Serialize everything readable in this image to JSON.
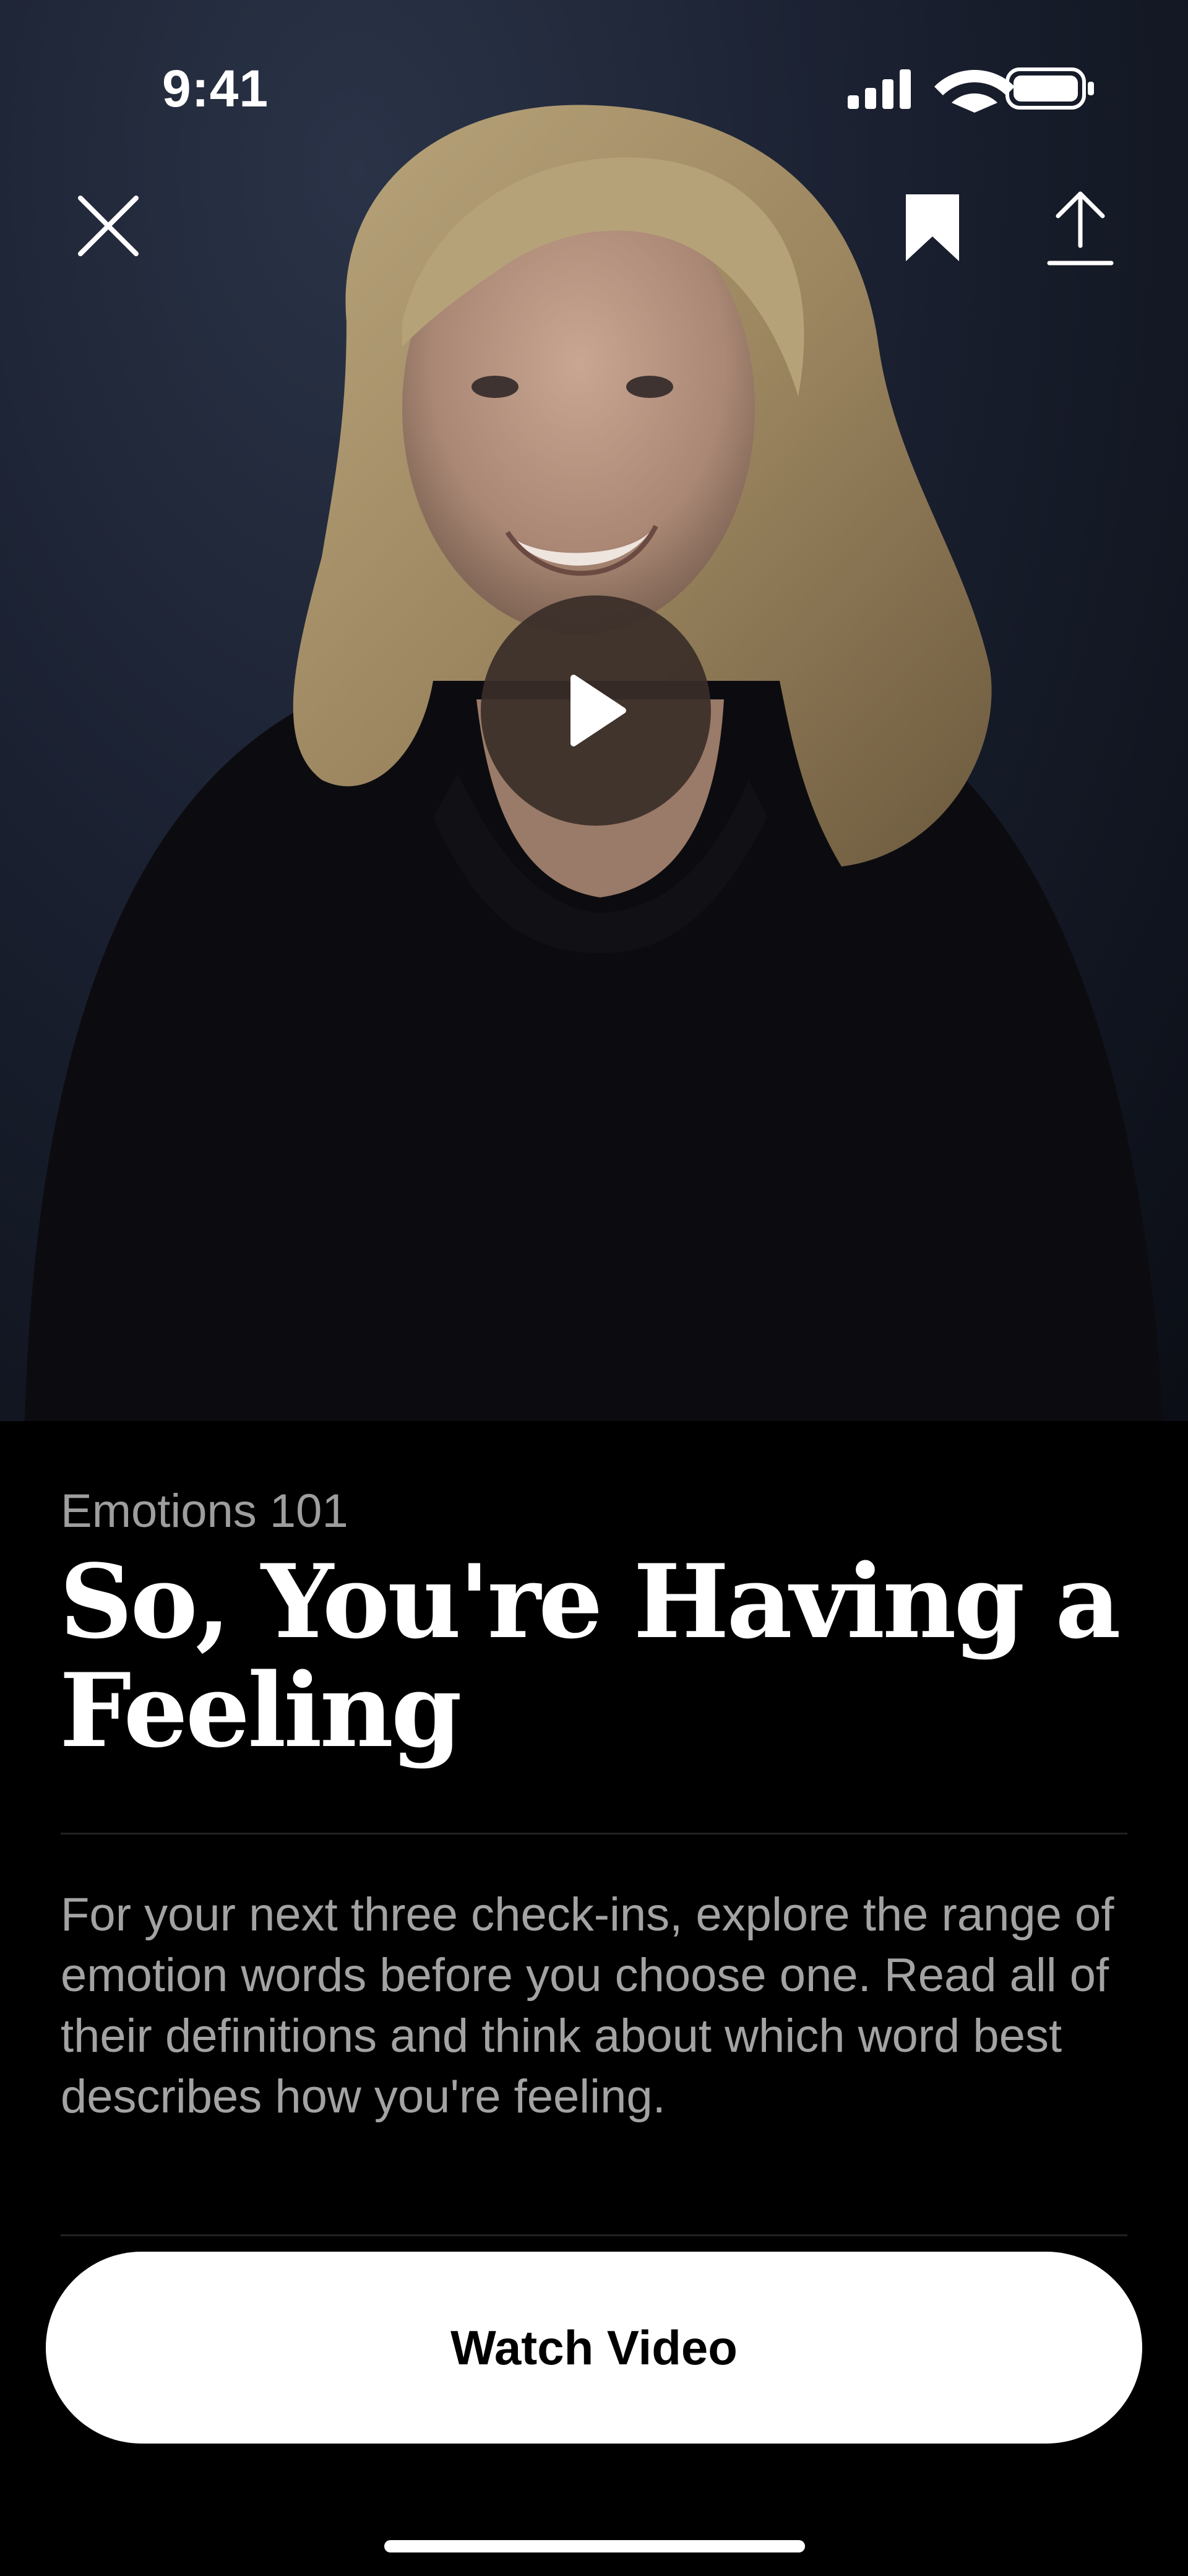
{
  "status_bar": {
    "time": "9:41"
  },
  "hero": {
    "close_icon": "close-icon",
    "bookmark_icon": "bookmark-icon",
    "share_icon": "share-icon",
    "play_icon": "play-icon"
  },
  "lesson": {
    "series": "Emotions 101",
    "title": "So, You're Having a Feeling",
    "description": "For your next three check-ins, explore the range of emotion words before you choose one. Read all of their definitions and think about which word best describes how you're feeling."
  },
  "actions": {
    "watch_label": "Watch Video"
  },
  "colors": {
    "background": "#000000",
    "button": "#ffffff",
    "muted_text": "#a3a3a3"
  }
}
